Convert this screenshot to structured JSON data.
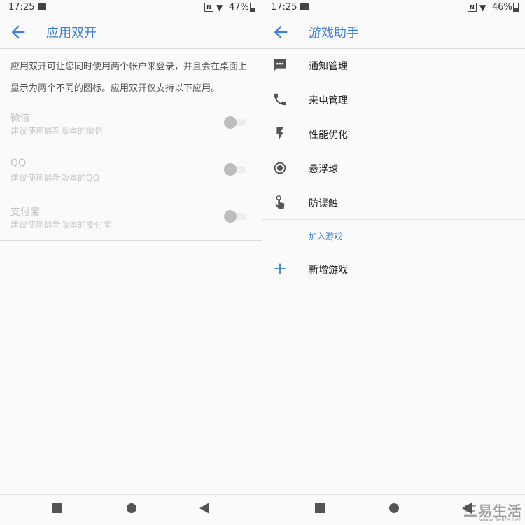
{
  "left": {
    "status": {
      "time": "17:25",
      "battery": "47%"
    },
    "title": "应用双开",
    "description": "应用双开可让您同时使用两个帐户来登录，并且会在桌面上显示为两个不同的图标。应用双开仅支持以下应用。",
    "apps": [
      {
        "name": "微信",
        "subtitle": "建议使用最新版本的微信",
        "enabled": false
      },
      {
        "name": "QQ",
        "subtitle": "建议使用最新版本的QQ",
        "enabled": false
      },
      {
        "name": "支付宝",
        "subtitle": "建议使用最新版本的支付宝",
        "enabled": false
      }
    ]
  },
  "right": {
    "status": {
      "time": "17:25",
      "battery": "46%"
    },
    "title": "游戏助手",
    "items": [
      {
        "label": "通知管理",
        "icon": "message-icon"
      },
      {
        "label": "来电管理",
        "icon": "phone-icon"
      },
      {
        "label": "性能优化",
        "icon": "flash-icon"
      },
      {
        "label": "悬浮球",
        "icon": "radio-button-icon"
      },
      {
        "label": "防误触",
        "icon": "touch-icon"
      }
    ],
    "section_header": "加入游戏",
    "add_game": {
      "label": "新增游戏",
      "icon": "plus-icon"
    }
  },
  "watermark": {
    "main": "三易生活",
    "sub": "www.3elife.net"
  },
  "colors": {
    "accent": "#3d7fd6",
    "icon": "#555555",
    "disabled_text": "#c2c2c2"
  }
}
